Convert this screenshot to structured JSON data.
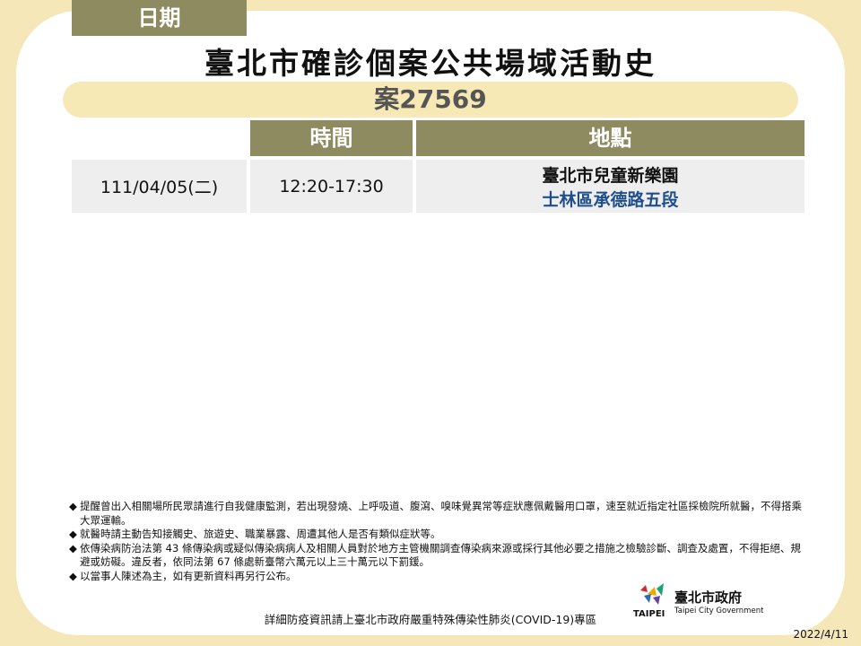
{
  "title": "臺北市確診個案公共場域活動史",
  "case": "案27569",
  "table": {
    "headers": [
      "日期",
      "時間",
      "地點"
    ],
    "rows": [
      {
        "date": "111/04/05(二)",
        "time": "12:20-17:30",
        "location": "臺北市兒童新樂園",
        "address": "士林區承德路五段"
      }
    ]
  },
  "notes": [
    "提醒曾出入相關場所民眾請進行自我健康監測，若出現發燒、上呼吸道、腹瀉、嗅味覺異常等症狀應佩戴醫用口罩，速至就近指定社區採檢院所就醫，不得搭乘大眾運輸。",
    "就醫時請主動告知接觸史、旅遊史、職業暴露、周遭其他人是否有類似症狀等。",
    "依傳染病防治法第 43 條傳染病或疑似傳染病病人及相關人員對於地方主管機關調查傳染病來源或採行其他必要之措施之檢驗診斷、調查及處置，不得拒絕、規避或妨礙。違反者，依同法第 67 條處新臺幣六萬元以上三十萬元以下罰鍰。",
    "以當事人陳述為主，如有更新資料再另行公布。"
  ],
  "bullet_glyph": "◆",
  "logo": {
    "name": "臺北市政府",
    "english": "Taipei City Government",
    "mark_text": "TAIPEI",
    "icon": "taipei-city-logo-icon"
  },
  "footer": "詳細防疫資訊請上臺北市政府嚴重特殊傳染性肺炎(COVID-19)專區",
  "date": "2022/4/11",
  "colors": {
    "background": "#F5E7B8",
    "header": "#8E8B61",
    "case_bar": "#F7E9B5",
    "address": "#1F4E8C"
  }
}
